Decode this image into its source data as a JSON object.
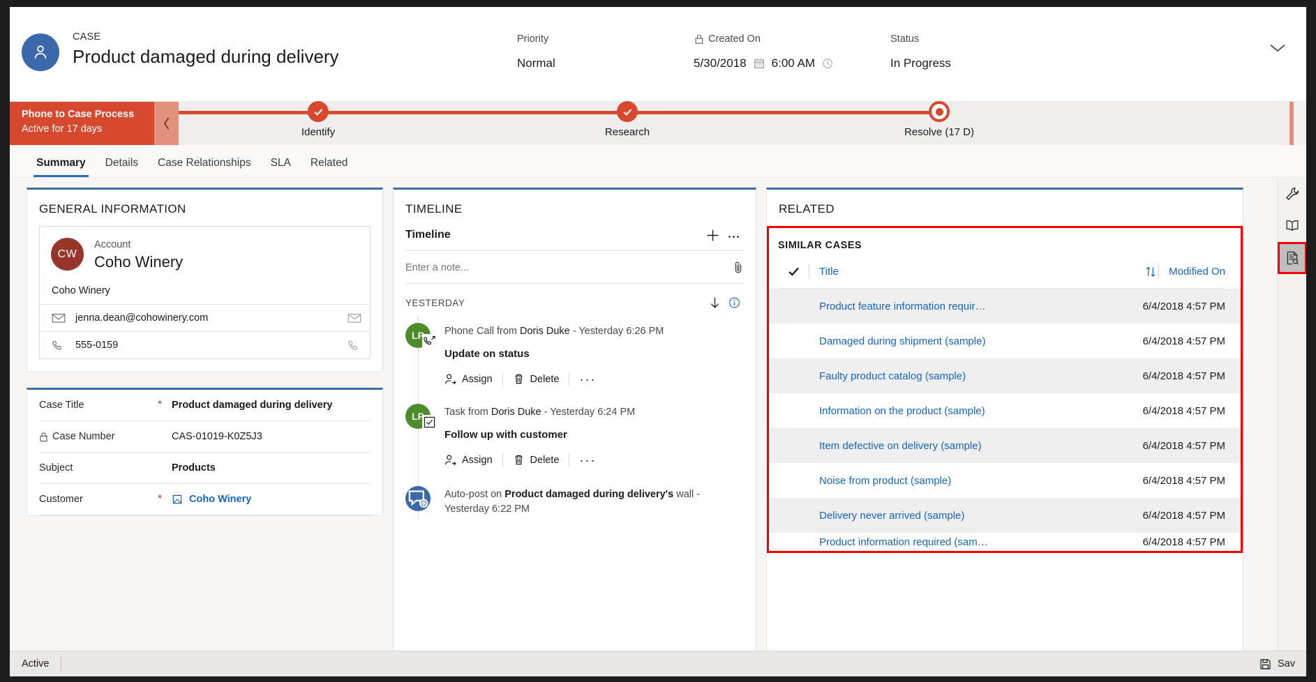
{
  "header": {
    "entity_label": "CASE",
    "title": "Product damaged during delivery",
    "fields": [
      {
        "label": "Priority",
        "value": "Normal",
        "icon": ""
      },
      {
        "label": "Created On",
        "value": "5/30/2018",
        "value2": "6:00 AM",
        "icon": "lock-icon"
      },
      {
        "label": "Status",
        "value": "In Progress",
        "icon": ""
      }
    ],
    "chevron": "chevron-down-icon"
  },
  "process": {
    "name": "Phone to Case Process",
    "subtitle": "Active for 17 days",
    "stages": [
      {
        "label": "Identify",
        "state": "complete"
      },
      {
        "label": "Research",
        "state": "complete"
      },
      {
        "label": "Resolve  (17 D)",
        "state": "current"
      }
    ]
  },
  "tabs": [
    {
      "label": "Summary",
      "active": true
    },
    {
      "label": "Details",
      "active": false
    },
    {
      "label": "Case Relationships",
      "active": false
    },
    {
      "label": "SLA",
      "active": false
    },
    {
      "label": "Related",
      "active": false
    }
  ],
  "general_information": {
    "section_title": "GENERAL INFORMATION",
    "account": {
      "avatar_initials": "CW",
      "label": "Account",
      "name": "Coho Winery",
      "sub_name": "Coho Winery",
      "rows": [
        {
          "icon": "mail-icon",
          "value": "jenna.dean@cohowinery.com",
          "action_icon": "send-mail-icon"
        },
        {
          "icon": "phone-icon",
          "value": "555-0159",
          "action_icon": "call-icon"
        }
      ]
    },
    "fields": [
      {
        "label": "Case Title",
        "required": true,
        "value": "Product damaged during delivery",
        "type": "text"
      },
      {
        "label": "Case Number",
        "required": false,
        "locked": true,
        "value": "CAS-01019-K0Z5J3",
        "type": "plain"
      },
      {
        "label": "Subject",
        "required": false,
        "value": "Products",
        "type": "text"
      },
      {
        "label": "Customer",
        "required": true,
        "value": "Coho Winery",
        "type": "link"
      }
    ]
  },
  "timeline": {
    "section_title": "TIMELINE",
    "header_label": "Timeline",
    "add_icon": "plus-icon",
    "more_icon": "ellipsis-icon",
    "note_placeholder": "Enter a note...",
    "attach_icon": "paperclip-icon",
    "date_group": "YESTERDAY",
    "sort_icon": "arrow-down-icon",
    "info_icon": "info-icon",
    "action_assign": "Assign",
    "action_delete": "Delete",
    "action_more": "···",
    "items": [
      {
        "badge": "LP",
        "badge_color": "green",
        "sub_icon": "phone-outgoing-icon",
        "prefix": "Phone Call from ",
        "who": "Doris Duke",
        "meta": "  -  Yesterday 6:26 PM",
        "body": "Update on status",
        "has_actions": true
      },
      {
        "badge": "LP",
        "badge_color": "green",
        "sub_icon": "task-checkbox-icon",
        "prefix": "Task from ",
        "who": "Doris Duke",
        "meta": "  -  Yesterday 6:24 PM",
        "body": "Follow up with customer",
        "has_actions": true
      },
      {
        "badge": "",
        "badge_color": "blue",
        "sub_icon": "autopost-icon",
        "prefix": "Auto-post on ",
        "who": "Product damaged during delivery's",
        "meta": " wall -  Yesterday 6:22 PM",
        "body": "",
        "has_actions": false
      }
    ]
  },
  "related": {
    "section_title": "RELATED",
    "similar_cases": {
      "title": "SIMILAR CASES",
      "select_all_icon": "checkmark-icon",
      "columns": [
        {
          "label": "Title"
        },
        {
          "label": "Modified On"
        }
      ],
      "sort_icon": "sort-icon",
      "rows": [
        {
          "title": "Product feature information requir…",
          "modified_on": "6/4/2018 4:57 PM"
        },
        {
          "title": "Damaged during shipment (sample)",
          "modified_on": "6/4/2018 4:57 PM"
        },
        {
          "title": "Faulty product catalog (sample)",
          "modified_on": "6/4/2018 4:57 PM"
        },
        {
          "title": "Information on the product (sample)",
          "modified_on": "6/4/2018 4:57 PM"
        },
        {
          "title": "Item defective on delivery (sample)",
          "modified_on": "6/4/2018 4:57 PM"
        },
        {
          "title": "Noise from product (sample)",
          "modified_on": "6/4/2018 4:57 PM"
        },
        {
          "title": "Delivery never arrived (sample)",
          "modified_on": "6/4/2018 4:57 PM"
        },
        {
          "title": "Product information required (sam…",
          "modified_on": "6/4/2018 4:57 PM"
        }
      ]
    }
  },
  "rail": {
    "buttons": [
      {
        "icon": "wrench-icon",
        "active": false
      },
      {
        "icon": "book-icon",
        "active": false
      },
      {
        "icon": "document-search-icon",
        "active": true
      }
    ]
  },
  "statusbar": {
    "state": "Active",
    "save_label": "Sav",
    "save_icon": "save-icon"
  },
  "colors": {
    "accent_blue": "#2a6cb5",
    "process_red": "#d6492f",
    "link_blue": "#1665bf",
    "highlight_red": "#f40000",
    "avatar_blue": "#3a68ab",
    "account_maroon": "#97352a",
    "timeline_green": "#4c8c2b"
  }
}
